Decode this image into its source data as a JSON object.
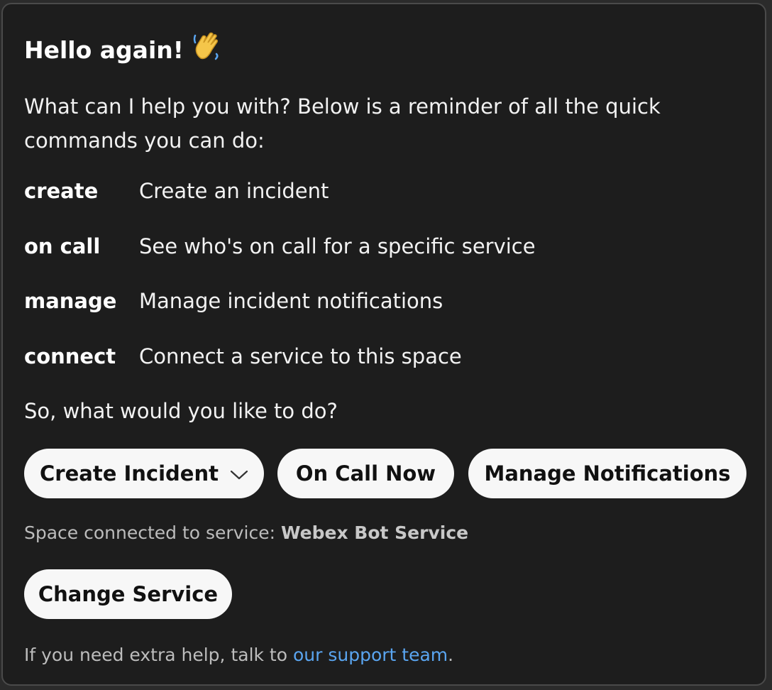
{
  "greeting": {
    "title": "Hello again!",
    "wave_icon": "waving-hand-icon"
  },
  "intro_text": "What can I help you with? Below is a reminder of all the quick commands you can do:",
  "commands": [
    {
      "key": "create",
      "desc": "Create an incident"
    },
    {
      "key": "on call",
      "desc": "See who's on call for a specific service"
    },
    {
      "key": "manage",
      "desc": "Manage incident notifications"
    },
    {
      "key": "connect",
      "desc": "Connect a service to this space"
    }
  ],
  "question": "So, what would you like to do?",
  "actions": {
    "create_incident": "Create Incident",
    "on_call_now": "On Call Now",
    "manage_notifications": "Manage Notifications"
  },
  "status": {
    "prefix": "Space connected to service: ",
    "service_name": "Webex Bot Service"
  },
  "change_service": "Change Service",
  "help": {
    "prefix": "If you need extra help, talk to ",
    "link": "our support team",
    "suffix": "."
  },
  "colors": {
    "background": "#1d1d1d",
    "button": "#f7f7f7",
    "link": "#5aa5f0"
  }
}
